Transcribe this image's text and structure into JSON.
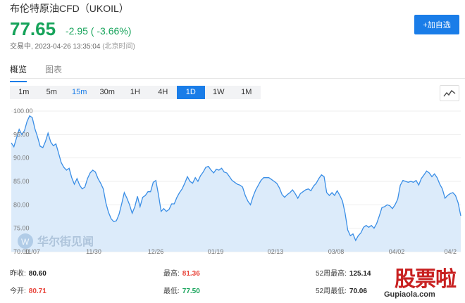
{
  "header": {
    "title": "布伦特原油CFD（UKOIL）",
    "price": "77.65",
    "change": "-2.95 ( -3.66%)",
    "status": "交易中, 2023-04-26 13:35:04",
    "timezone": "(北京时间)",
    "add_button": "+加自选"
  },
  "tabs": [
    {
      "label": "概览",
      "active": true
    },
    {
      "label": "图表",
      "active": false
    }
  ],
  "ranges": [
    "1m",
    "5m",
    "15m",
    "30m",
    "1H",
    "4H",
    "1D",
    "1W",
    "1M"
  ],
  "active_range": "1D",
  "highlighted_range": "15m",
  "chart_type_icon": "line-chart-icon",
  "watermark_text": "华尔街见闻",
  "chart_data": {
    "type": "area",
    "x_tick_labels": [
      "11/07",
      "11/30",
      "12/26",
      "01/19",
      "02/13",
      "03/08",
      "04/02",
      "04/2"
    ],
    "y_tick_labels": [
      "100.00",
      "95.00",
      "90.00",
      "85.00",
      "80.00",
      "75.00",
      "70.00"
    ],
    "ylim": [
      70,
      100
    ],
    "grid": "horizontal",
    "color": "#3a8ee6",
    "fill": "#dcebfa",
    "values": [
      93.2,
      92.4,
      94.3,
      96.1,
      95.0,
      95.8,
      97.8,
      99.0,
      98.6,
      96.2,
      94.5,
      92.5,
      92.2,
      93.5,
      95.3,
      93.4,
      92.6,
      93.0,
      91.0,
      89.0,
      88.0,
      87.4,
      87.8,
      85.8,
      84.4,
      85.6,
      84.2,
      83.4,
      83.8,
      85.6,
      86.8,
      87.4,
      87.0,
      85.6,
      84.6,
      83.4,
      80.4,
      78.4,
      77.0,
      76.4,
      76.6,
      78.0,
      80.2,
      82.6,
      81.4,
      80.0,
      78.2,
      79.6,
      81.8,
      79.6,
      81.6,
      82.0,
      82.8,
      82.8,
      84.8,
      85.2,
      82.2,
      78.6,
      79.2,
      78.6,
      79.0,
      80.2,
      80.2,
      81.6,
      82.6,
      83.4,
      84.6,
      86.0,
      85.0,
      84.6,
      85.8,
      85.0,
      86.2,
      87.0,
      88.0,
      88.2,
      87.4,
      86.8,
      87.6,
      87.4,
      87.8,
      87.0,
      86.8,
      86.0,
      85.2,
      84.8,
      84.4,
      84.2,
      83.8,
      82.0,
      80.8,
      80.0,
      81.8,
      83.2,
      84.2,
      85.2,
      85.8,
      85.8,
      85.8,
      85.4,
      85.0,
      84.6,
      83.6,
      82.2,
      81.6,
      82.2,
      82.6,
      83.2,
      82.4,
      81.4,
      82.4,
      82.8,
      83.2,
      83.4,
      83.0,
      84.0,
      84.6,
      85.6,
      86.4,
      86.0,
      82.6,
      82.0,
      82.6,
      82.0,
      83.0,
      82.0,
      80.8,
      78.2,
      74.6,
      73.4,
      73.8,
      72.4,
      73.4,
      74.0,
      75.2,
      75.6,
      75.2,
      75.6,
      75.0,
      76.0,
      77.6,
      79.4,
      79.6,
      80.0,
      79.8,
      79.2,
      80.0,
      81.2,
      84.2,
      85.2,
      85.0,
      84.8,
      85.0,
      84.8,
      85.2,
      84.2,
      85.6,
      86.4,
      87.2,
      86.8,
      86.0,
      86.6,
      85.8,
      84.4,
      83.4,
      81.4,
      82.0,
      82.4,
      82.6,
      82.0,
      80.4,
      77.65
    ]
  },
  "stats": {
    "prev_close": {
      "label": "昨收:",
      "value": "80.60"
    },
    "open": {
      "label": "今开:",
      "value": "80.71"
    },
    "high": {
      "label": "最高:",
      "value": "81.36"
    },
    "low": {
      "label": "最低:",
      "value": "77.50"
    },
    "week52_high": {
      "label": "52周最高:",
      "value": "125.14"
    },
    "week52_low": {
      "label": "52周最低:",
      "value": "70.06"
    }
  },
  "brand": {
    "logo_text": "股票啦",
    "url": "Gupiaola.com"
  }
}
